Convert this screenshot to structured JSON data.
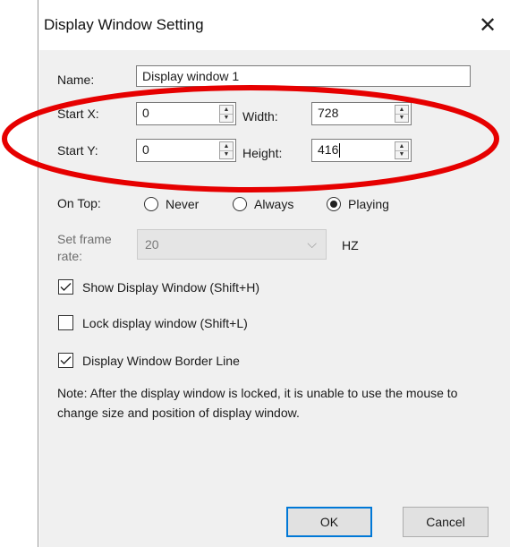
{
  "dialog": {
    "title": "Display Window Setting",
    "close_glyph": "✕"
  },
  "form": {
    "name_label": "Name:",
    "name_value": "Display window 1",
    "start_x_label": "Start X:",
    "start_x_value": "0",
    "width_label": "Width:",
    "width_value": "728",
    "start_y_label": "Start Y:",
    "start_y_value": "0",
    "height_label": "Height:",
    "height_value": "416",
    "on_top_label": "On Top:",
    "on_top_options": [
      {
        "label": "Never",
        "checked": false
      },
      {
        "label": "Always",
        "checked": false
      },
      {
        "label": "Playing",
        "checked": true
      }
    ],
    "frame_rate_label_1": "Set frame",
    "frame_rate_label_2": "rate:",
    "frame_rate_value": "20",
    "frame_rate_unit": "HZ"
  },
  "checkboxes": [
    {
      "label": "Show Display Window (Shift+H)",
      "checked": true
    },
    {
      "label": "Lock display window (Shift+L)",
      "checked": false
    },
    {
      "label": "Display Window Border Line",
      "checked": true
    }
  ],
  "note": "Note: After the display window is locked, it is unable to use the mouse to change size and position of display window.",
  "buttons": {
    "ok": "OK",
    "cancel": "Cancel"
  },
  "colors": {
    "dialog_bg": "#f0f0f0",
    "annotation": "#e60000",
    "default_button_border": "#0078d7"
  },
  "icons": {
    "close": "close-icon",
    "spin": "spin-arrows-icon",
    "dropdown": "chevron-down-icon",
    "check": "checkmark-icon"
  }
}
